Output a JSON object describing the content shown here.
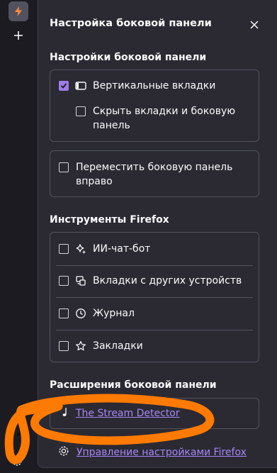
{
  "rail": {
    "active_icon": "lightning-icon",
    "add_icon": "plus-icon",
    "extension_icon": "music-note-icon",
    "settings_icon": "gear-icon"
  },
  "panel": {
    "title": "Настройка боковой панели",
    "close_icon": "close-icon"
  },
  "sidebar_settings": {
    "heading": "Настройки боковой панели",
    "vertical_tabs": {
      "label": "Вертикальные вкладки",
      "checked": true,
      "icon": "sidebar-icon"
    },
    "hide_tabs": {
      "label_line1": "Скрыть вкладки и боковую",
      "label_line2": "панель",
      "checked": false
    },
    "move_right": {
      "label_line1": "Переместить боковую панель",
      "label_line2": "вправо",
      "checked": false
    }
  },
  "firefox_tools": {
    "heading": "Инструменты Firefox",
    "items": [
      {
        "label": "ИИ-чат-бот",
        "icon": "sparkle-icon",
        "checked": false
      },
      {
        "label": "Вкладки с других устройств",
        "icon": "synced-devices-icon",
        "checked": false
      },
      {
        "label": "Журнал",
        "icon": "history-clock-icon",
        "checked": false
      },
      {
        "label": "Закладки",
        "icon": "star-icon",
        "checked": false
      }
    ]
  },
  "extensions": {
    "heading": "Расширения боковой панели",
    "items": [
      {
        "label": "The Stream Detector",
        "icon": "music-note-icon"
      }
    ]
  },
  "manage": {
    "label": "Управление настройками Firefox",
    "icon": "gear-icon"
  },
  "colors": {
    "accent": "#9d7ce8",
    "link": "#a686f5",
    "annotation": "#ff7a00",
    "panel_bg": "#2b2a33",
    "rail_bg": "#1c1b22"
  }
}
